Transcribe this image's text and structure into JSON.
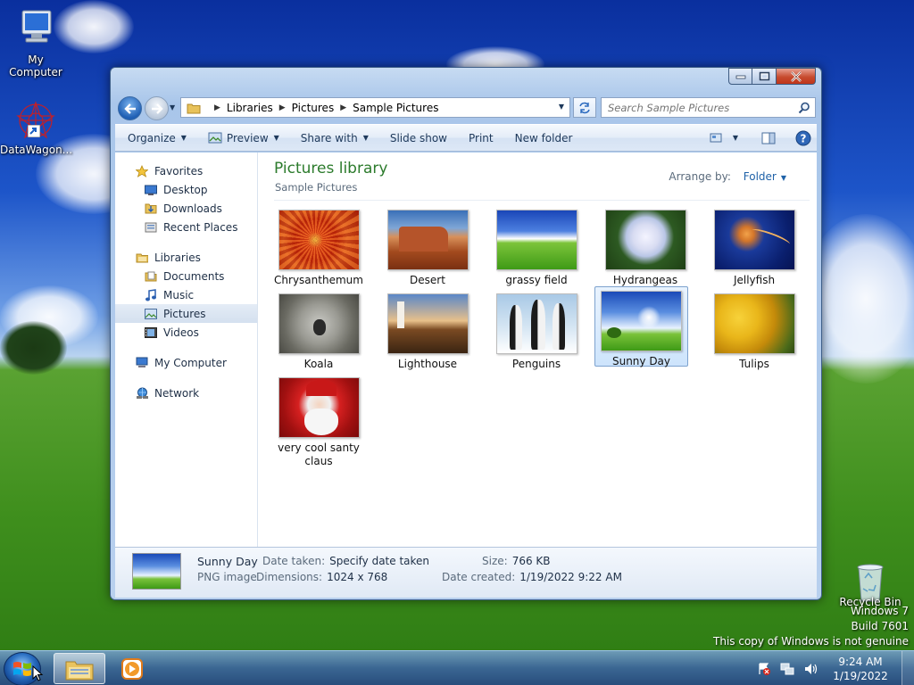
{
  "desktop": {
    "icons": [
      {
        "label": "My Computer"
      },
      {
        "label": "DataWagon..."
      },
      {
        "label": "Recycle Bin"
      }
    ],
    "watermark": {
      "line1": "Windows 7",
      "line2": "Build 7601",
      "line3": "This copy of Windows is not genuine"
    }
  },
  "window": {
    "address": {
      "crumbs": [
        "Libraries",
        "Pictures",
        "Sample Pictures"
      ]
    },
    "search": {
      "placeholder": "Search Sample Pictures"
    },
    "toolbar": {
      "organize": "Organize",
      "preview": "Preview",
      "share_with": "Share with",
      "slide_show": "Slide show",
      "print": "Print",
      "new_folder": "New folder"
    },
    "sidebar": {
      "favorites": "Favorites",
      "favorites_items": [
        "Desktop",
        "Downloads",
        "Recent Places"
      ],
      "libraries": "Libraries",
      "libraries_items": [
        "Documents",
        "Music",
        "Pictures",
        "Videos"
      ],
      "my_computer": "My Computer",
      "network": "Network",
      "selected": "Pictures"
    },
    "content": {
      "title": "Pictures library",
      "subtitle": "Sample Pictures",
      "arrange_label": "Arrange by:",
      "arrange_value": "Folder",
      "items": [
        {
          "name": "Chrysanthemum"
        },
        {
          "name": "Desert"
        },
        {
          "name": "grassy field"
        },
        {
          "name": "Hydrangeas"
        },
        {
          "name": "Jellyfish"
        },
        {
          "name": "Koala"
        },
        {
          "name": "Lighthouse"
        },
        {
          "name": "Penguins"
        },
        {
          "name": "Sunny Day"
        },
        {
          "name": "Tulips"
        },
        {
          "name": "very cool santy claus"
        }
      ],
      "selected": "Sunny Day"
    },
    "details": {
      "name": "Sunny Day",
      "type": "PNG image",
      "date_taken_label": "Date taken:",
      "date_taken": "Specify date taken",
      "dimensions_label": "Dimensions:",
      "dimensions": "1024 x 768",
      "size_label": "Size:",
      "size": "766 KB",
      "date_created_label": "Date created:",
      "date_created": "1/19/2022 9:22 AM"
    }
  },
  "taskbar": {
    "time": "9:24 AM",
    "date": "1/19/2022"
  },
  "colors": {
    "library_title": "#2c7b2c",
    "link_blue": "#1f62a8",
    "selection_border": "#7da2ce"
  }
}
